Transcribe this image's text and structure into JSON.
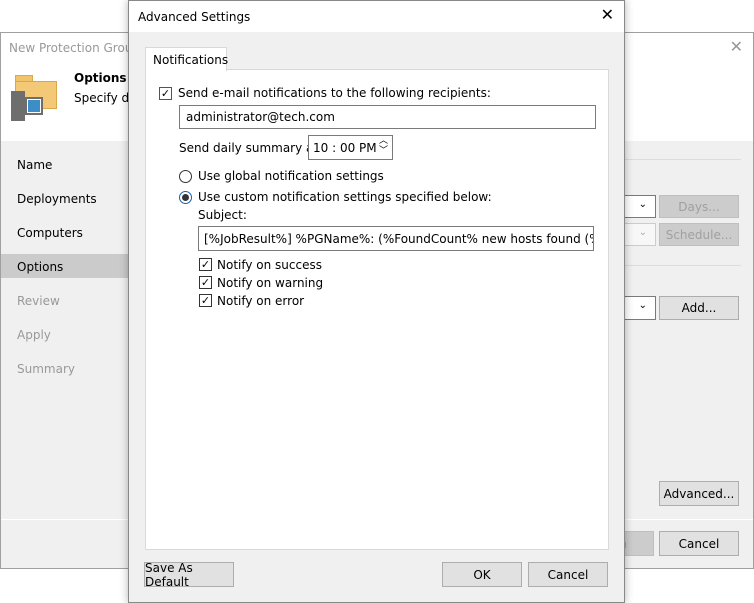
{
  "background_window": {
    "title": "New Protection Group",
    "header_title": "Options",
    "header_subtitle": "Specify dis",
    "nav": [
      {
        "label": "Name",
        "state": "normal"
      },
      {
        "label": "Deployments",
        "state": "normal"
      },
      {
        "label": "Computers",
        "state": "normal"
      },
      {
        "label": "Options",
        "state": "selected"
      },
      {
        "label": "Review",
        "state": "disabled"
      },
      {
        "label": "Apply",
        "state": "disabled"
      },
      {
        "label": "Summary",
        "state": "disabled"
      }
    ],
    "buttons": {
      "days": "Days...",
      "schedule": "Schedule...",
      "add": "Add...",
      "advanced": "Advanced...",
      "finish": "n",
      "cancel": "Cancel"
    }
  },
  "dialog": {
    "title": "Advanced Settings",
    "tab": "Notifications",
    "send_email": {
      "label": "Send e-mail notifications to the following recipients:",
      "checked": true
    },
    "recipients": "administrator@tech.com",
    "daily_summary_label": "Send daily summary at:",
    "daily_summary_time": "10 : 00 PM",
    "radio_global": {
      "label": "Use global notification settings",
      "selected": false
    },
    "radio_custom": {
      "label": "Use custom notification settings specified below:",
      "selected": true
    },
    "subject_label": "Subject:",
    "subject": "[%JobResult%] %PGName%: (%FoundCount% new hosts found (%TotalCo",
    "notify": [
      {
        "label": "Notify on success",
        "checked": true
      },
      {
        "label": "Notify on warning",
        "checked": true
      },
      {
        "label": "Notify on error",
        "checked": true
      }
    ],
    "buttons": {
      "save_default": "Save As Default",
      "ok": "OK",
      "cancel": "Cancel"
    }
  }
}
